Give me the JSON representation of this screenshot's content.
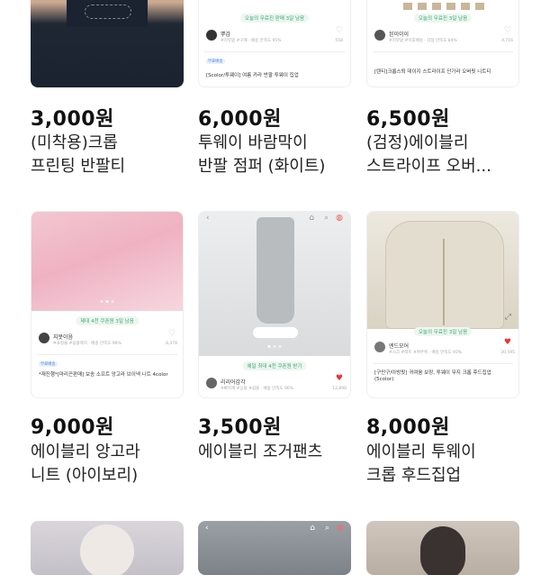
{
  "products": [
    {
      "price": "3,000원",
      "title_lines": [
        "(미착용)크롭",
        "프린팅 반팔티"
      ],
      "thumb": {}
    },
    {
      "price": "6,000원",
      "title_lines": [
        "투웨이 바람막이",
        "반팔 점퍼 (화이트)"
      ],
      "thumb": {
        "badge": "오늘의 무료진 판매 3일 남음",
        "seller_name": "뿌감",
        "seller_meta": "#리뷰없 #구매 · 배송 만족도 95%",
        "heart_count": "558",
        "tag": "무료배송",
        "desc": "[Scolor/투웨이] 여름 카라 반팔 투웨이 집업"
      }
    },
    {
      "price": "6,500원",
      "title_lines": [
        "(검정)에이블리",
        "스트라이프 오버..."
      ],
      "thumb": {
        "badge": "오늘의 무료진 3일 남음",
        "seller_name": "된이이이",
        "seller_meta": "#리뷰없 #이후배송 · 각점 만족도 84%",
        "heart_count": "4,716",
        "desc": "[텐티]크롭스퇴 데이지 스트라이프 단가라 오버핏 니트티"
      }
    },
    {
      "price": "9,000원",
      "title_lines": [
        "에이블리 앙고라",
        "니트 (아이보리)"
      ],
      "thumb": {
        "badge": "제대 4천 쿠폰원 3일 남음",
        "seller_name": "지못이음",
        "seller_meta": "#쇼핑몰 #쉼볼매치 · 배송 만족도 96%",
        "heart_count": "8,478",
        "tag": "무료배송",
        "desc": "*재진행*[마리끈판매] 보송 소프트 앙고라 브이넥 니트 4color"
      }
    },
    {
      "price": "3,500원",
      "title_lines": [
        "에이블리 조거팬츠"
      ],
      "thumb": {
        "badge": "예일 최대 4천 쿠폰원 받기",
        "seller_name": "리리어감각",
        "seller_meta": "#빠지계 #심플 #쉼볼 · 배송 만족도 96%",
        "heart_count": "12,898",
        "desc": ""
      }
    },
    {
      "price": "8,000원",
      "title_lines": [
        "에이블리 투웨이",
        "크롭 후드집업"
      ],
      "thumb": {
        "badge": "오늘의 무료진 3일 남음",
        "seller_name": "엔드모어",
        "seller_meta": "#시크 #레트 #여주룩 · 배송 만족도 93%",
        "heart_count": "30,595",
        "desc": "[구만구/아방핏] 귀여움 보장, 투웨이 무지 크롭 후드집업 (5color)"
      }
    }
  ],
  "colors": {
    "price_text": "#111111",
    "title_text": "#222222",
    "heart": "#e33333",
    "badge_green": "#33aa77"
  }
}
